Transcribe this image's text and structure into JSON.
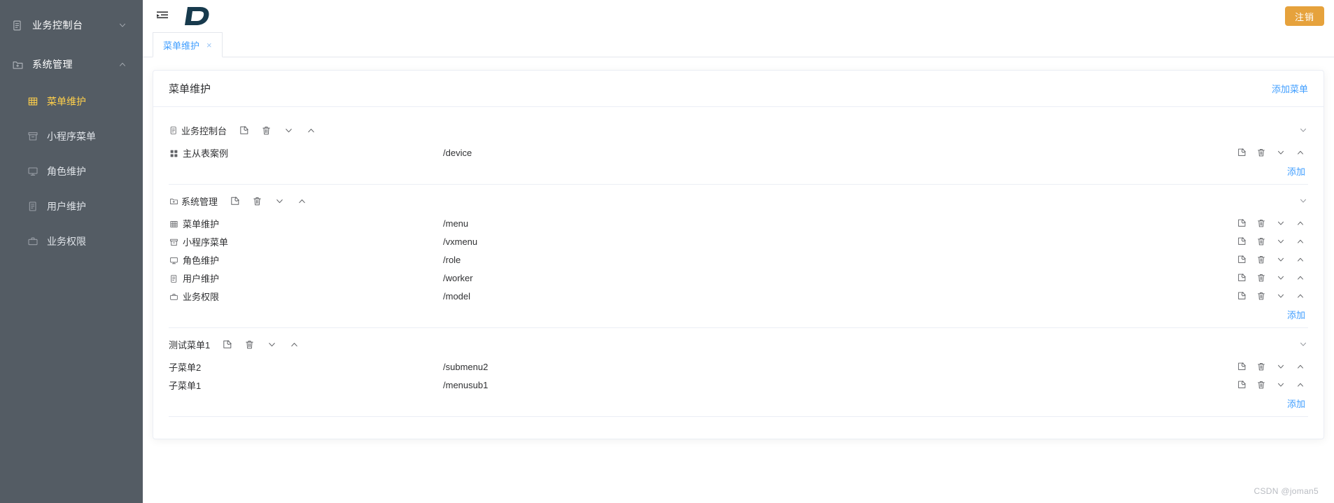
{
  "sidebar": {
    "groups": [
      {
        "id": "business-console",
        "label": "业务控制台",
        "icon": "file-copy-icon",
        "arrow": "chevron-down-icon",
        "expanded": false,
        "items": []
      },
      {
        "id": "system-management",
        "label": "系统管理",
        "icon": "folder-add-icon",
        "arrow": "chevron-up-icon",
        "expanded": true,
        "items": [
          {
            "label": "菜单维护",
            "icon": "table-grid-icon",
            "active": true
          },
          {
            "label": "小程序菜单",
            "icon": "archive-icon",
            "active": false
          },
          {
            "label": "角色维护",
            "icon": "monitor-icon",
            "active": false
          },
          {
            "label": "用户维护",
            "icon": "document-list-icon",
            "active": false
          },
          {
            "label": "业务权限",
            "icon": "briefcase-icon",
            "active": false
          }
        ]
      }
    ]
  },
  "topbar": {
    "menu_toggle_icon": "menu-fold-icon",
    "logo_text": "D",
    "logo_color": "#173a4d",
    "logout_label": "注销",
    "logout_color": "#e6a23c"
  },
  "tabs": [
    {
      "label": "菜单维护",
      "closable": true,
      "close_glyph": "×",
      "active": true
    }
  ],
  "card": {
    "title": "菜单维护",
    "add_menu_label": "添加菜单",
    "accent_color": "#409eff"
  },
  "menu_groups": [
    {
      "id": "group-business-console",
      "icon": "file-copy-icon",
      "label": "业务控制台",
      "actions": [
        "edit-icon",
        "delete-icon",
        "chevron-down-icon",
        "chevron-up-icon"
      ],
      "collapse_icon": "chevron-down-icon",
      "rows": [
        {
          "icon": "appstore-grid-icon",
          "name": "主从表案例",
          "path": "/device"
        }
      ],
      "add_label": "添加"
    },
    {
      "id": "group-system-management",
      "icon": "folder-add-icon",
      "label": "系统管理",
      "actions": [
        "edit-icon",
        "delete-icon",
        "chevron-down-icon",
        "chevron-up-icon"
      ],
      "collapse_icon": "chevron-down-icon",
      "rows": [
        {
          "icon": "table-grid-icon",
          "name": "菜单维护",
          "path": "/menu"
        },
        {
          "icon": "archive-icon",
          "name": "小程序菜单",
          "path": "/vxmenu"
        },
        {
          "icon": "monitor-icon",
          "name": "角色维护",
          "path": "/role"
        },
        {
          "icon": "document-list-icon",
          "name": "用户维护",
          "path": "/worker"
        },
        {
          "icon": "briefcase-icon",
          "name": "业务权限",
          "path": "/model"
        }
      ],
      "add_label": "添加"
    },
    {
      "id": "group-test-menu-1",
      "icon": "",
      "label": "测试菜单1",
      "actions": [
        "edit-icon",
        "delete-icon",
        "chevron-down-icon",
        "chevron-up-icon"
      ],
      "collapse_icon": "chevron-down-icon",
      "rows": [
        {
          "icon": "",
          "name": "子菜单2",
          "path": "/submenu2"
        },
        {
          "icon": "",
          "name": "子菜单1",
          "path": "/menusub1"
        }
      ],
      "add_label": "添加"
    }
  ],
  "row_actions": [
    "edit-icon",
    "delete-icon",
    "chevron-down-icon",
    "chevron-up-icon"
  ],
  "watermark": "CSDN @joman5"
}
